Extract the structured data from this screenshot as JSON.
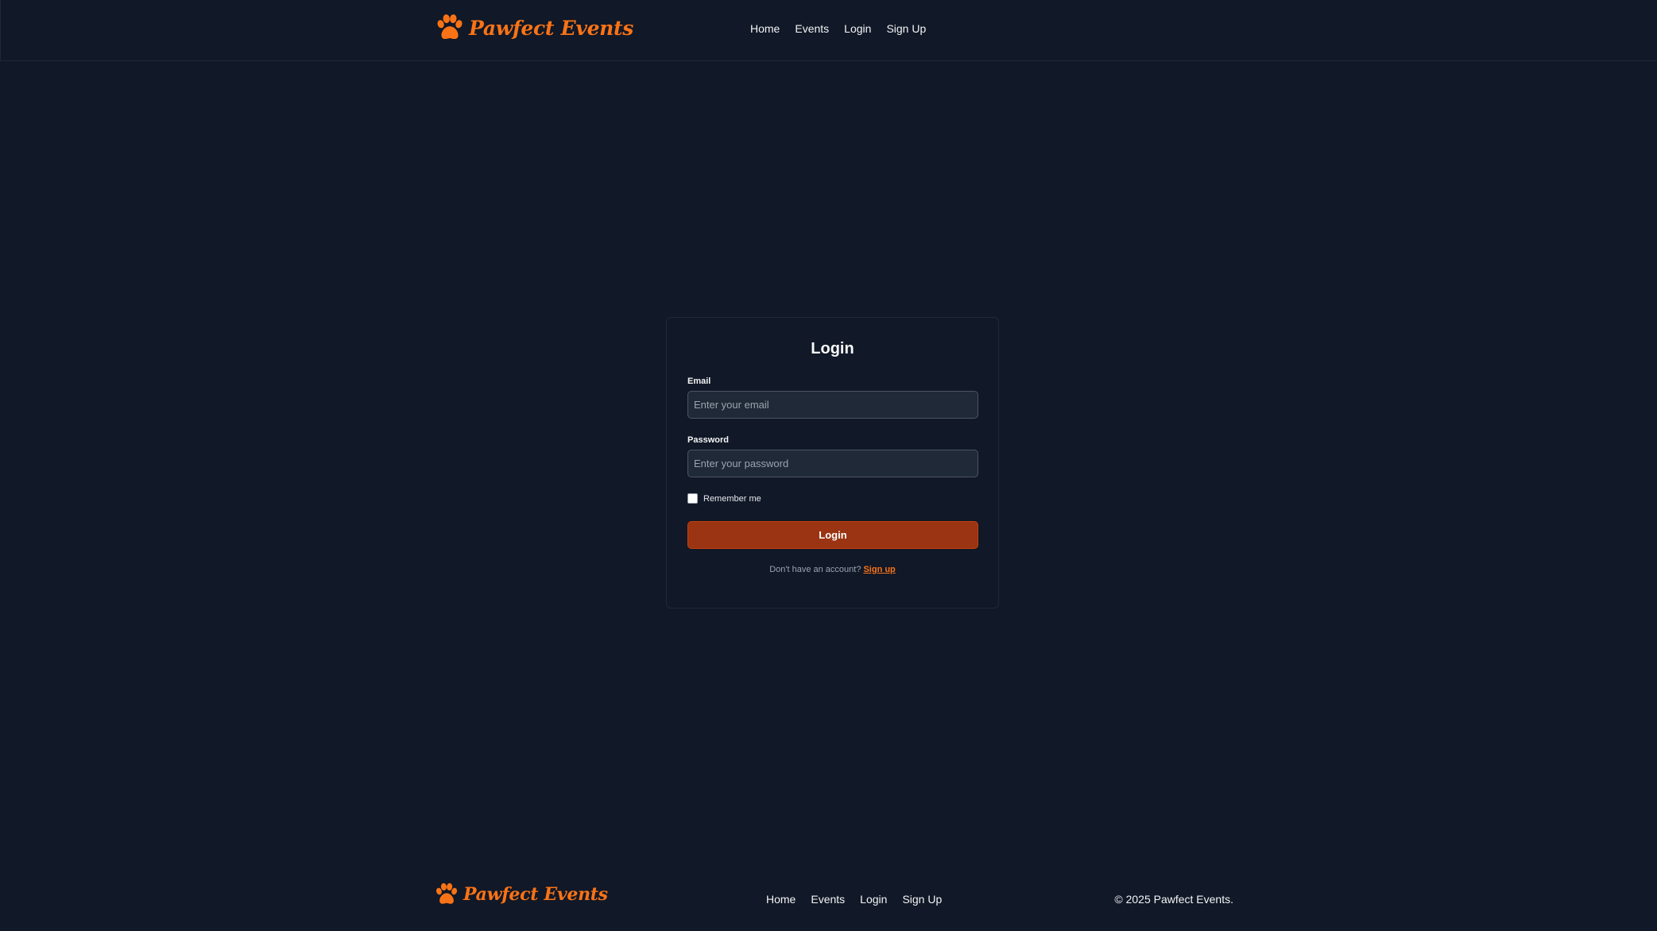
{
  "brand": {
    "name": "Pawfect Events",
    "icon": "paw-icon",
    "color": "#f97316"
  },
  "header": {
    "nav": [
      "Home",
      "Events",
      "Login",
      "Sign Up"
    ]
  },
  "login": {
    "title": "Login",
    "email": {
      "label": "Email",
      "placeholder": "Enter your email",
      "value": ""
    },
    "password": {
      "label": "Password",
      "placeholder": "Enter your password",
      "value": ""
    },
    "remember": {
      "label": "Remember me",
      "checked": false
    },
    "submit_label": "Login",
    "signup_prompt": "Don't have an account?",
    "signup_link": "Sign up"
  },
  "footer": {
    "nav": [
      "Home",
      "Events",
      "Login",
      "Sign Up"
    ],
    "copyright": "© 2025 Pawfect Events."
  },
  "colors": {
    "background": "#111827",
    "input_bg": "#1f2937",
    "button_bg": "#9a3412",
    "accent": "#f97316"
  }
}
